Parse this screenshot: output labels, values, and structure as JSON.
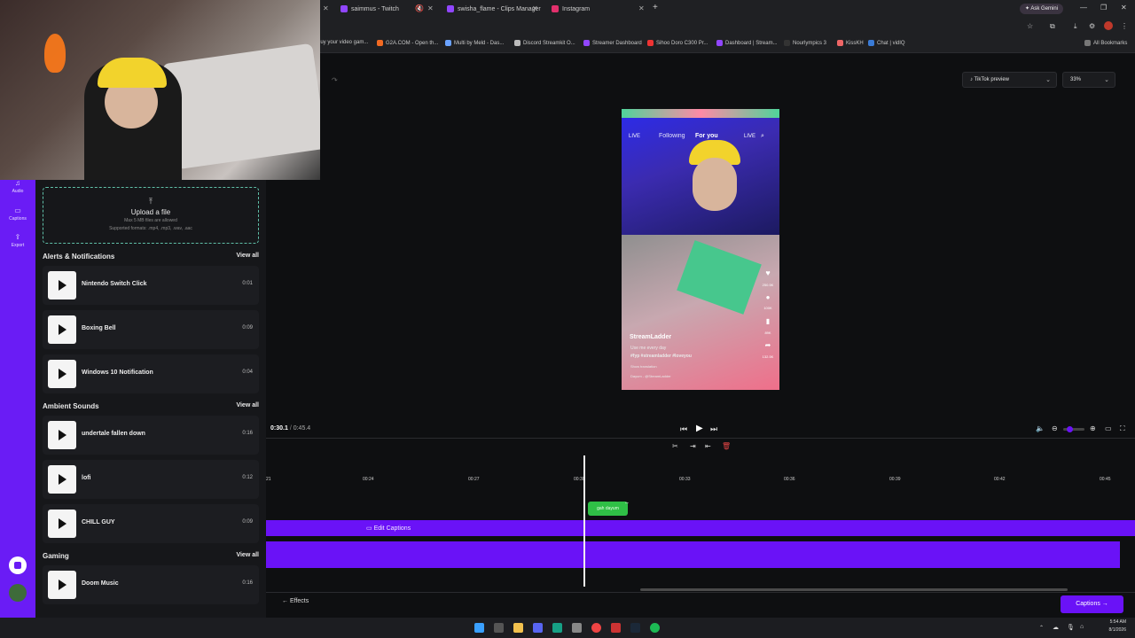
{
  "browser": {
    "tabs": [
      {
        "title": "saimmus - Twitch",
        "color": "#9146ff"
      },
      {
        "title": "swisha_flame - Clips Manager",
        "color": "#9146ff"
      },
      {
        "title": "Instagram",
        "color": "#e1306c"
      }
    ],
    "new_tab": "+",
    "ask_gemini": "Ask Gemini",
    "bookmarks": [
      "luy your video gam...",
      "G2A.COM - Open th...",
      "Multi by Meld - Das...",
      "Discord Streamkit O...",
      "Streamer Dashboard",
      "Sihoo Doro C300 Pr...",
      "Dashboard | Stream...",
      "Nourlympics 3",
      "KissKH",
      "Chat | vidIQ"
    ],
    "all_bookmarks": "All Bookmarks"
  },
  "rail": [
    {
      "label": "Audio",
      "icon": "music-icon"
    },
    {
      "label": "Captions",
      "icon": "captions-icon"
    },
    {
      "label": "Export",
      "icon": "export-icon"
    }
  ],
  "upload": {
    "icon": "⤒",
    "title": "Upload a file",
    "sub1": "Max 5 MB files are allowed",
    "sub2": "Supported formats: .mp4, .mp3, .wav, .aac"
  },
  "sections": {
    "alerts": {
      "title": "Alerts & Notifications",
      "view_all": "View all"
    },
    "ambient": {
      "title": "Ambient Sounds",
      "view_all": "View all"
    },
    "gaming": {
      "title": "Gaming",
      "view_all": "View all"
    }
  },
  "sounds": [
    {
      "name": "Nintendo Switch Click",
      "duration": "0:01"
    },
    {
      "name": "Boxing Bell",
      "duration": "0:09"
    },
    {
      "name": "Windows 10 Notification",
      "duration": "0:04"
    },
    {
      "name": "undertale fallen down",
      "duration": "0:16"
    },
    {
      "name": "lofi",
      "duration": "0:12"
    },
    {
      "name": "CHILL GUY",
      "duration": "0:09"
    },
    {
      "name": "Doom Music",
      "duration": "0:16"
    }
  ],
  "preview_controls": {
    "tiktok_preview": "TikTok preview",
    "zoom": "33%"
  },
  "preview": {
    "following": "Following",
    "for_you": "For you",
    "username": "StreamLadder",
    "caption_line": "Use me every day",
    "hashtags": "#fyp #streamladder #loveyou",
    "show_translation": "Show translation",
    "music": "Dayum - @StreamLadder",
    "likes": "250.5K",
    "comments": "100K",
    "saves": "89K",
    "shares": "132.5K"
  },
  "player": {
    "current": "0:30.1",
    "separator": "/",
    "total": "0:45.4"
  },
  "timeline": {
    "ticks": [
      "21",
      "00:24",
      "00:27",
      "00:30",
      "00:33",
      "00:36",
      "00:39",
      "00:42",
      "00:45"
    ],
    "clip_label": "gah dayum",
    "edit_captions": "Edit Captions"
  },
  "footer": {
    "effects": "Effects",
    "captions": "Captions"
  },
  "taskbar": {
    "time": "5:54 AM",
    "date": "8/1/2026"
  }
}
